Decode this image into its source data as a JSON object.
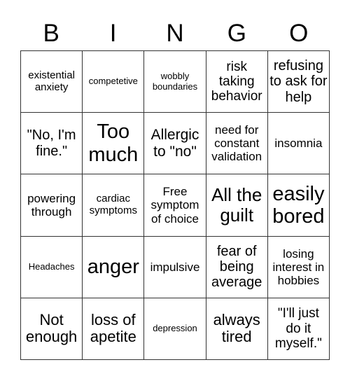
{
  "header": {
    "letters": [
      "B",
      "I",
      "N",
      "G",
      "O"
    ]
  },
  "board": {
    "rows": [
      [
        "existential anxiety",
        "competetive",
        "wobbly boundaries",
        "risk taking behavior",
        "refusing to ask for help"
      ],
      [
        "\"No, I'm fine.\"",
        "Too much",
        "Allergic to \"no\"",
        "need for constant validation",
        "insomnia"
      ],
      [
        "powering through",
        "cardiac symptoms",
        "Free symptom of choice",
        "All the guilt",
        "easily bored"
      ],
      [
        "Headaches",
        "anger",
        "impulsive",
        "fear of being average",
        "losing interest in hobbies"
      ],
      [
        "Not enough",
        "loss of apetite",
        "depression",
        "always tired",
        "\"I'll just do it myself.\""
      ]
    ]
  },
  "colors": {
    "grid_line": "#333333",
    "background": "#ffffff",
    "text": "#000000"
  }
}
